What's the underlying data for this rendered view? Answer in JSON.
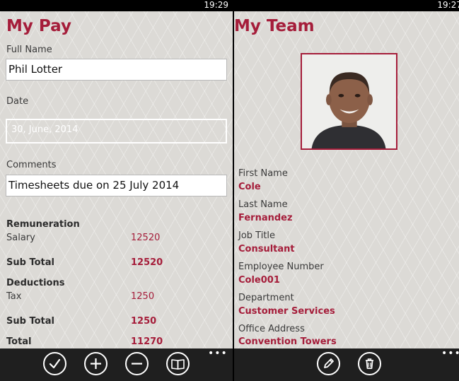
{
  "left": {
    "clock": "19:29",
    "title": "My Pay",
    "full_name": {
      "label": "Full Name",
      "value": "Phil Lotter"
    },
    "date": {
      "label": "Date",
      "value": "30, June, 2014"
    },
    "comments": {
      "label": "Comments",
      "value": "Timesheets due on 25 July 2014"
    },
    "remuneration_heading": "Remuneration",
    "salary": {
      "label": "Salary",
      "value": "12520"
    },
    "sub_total_1": {
      "label": "Sub Total",
      "value": "12520"
    },
    "deductions_heading": "Deductions",
    "tax": {
      "label": "Tax",
      "value": "1250"
    },
    "sub_total_2": {
      "label": "Sub Total",
      "value": "1250"
    },
    "total": {
      "label": "Total",
      "value": "11270"
    },
    "appbar_icons": [
      "check-icon",
      "add-icon",
      "remove-icon",
      "book-icon"
    ],
    "more": "•••"
  },
  "right": {
    "clock": "19:27",
    "title": "My Team",
    "first_name": {
      "label": "First Name",
      "value": "Cole"
    },
    "last_name": {
      "label": "Last Name",
      "value": "Fernandez"
    },
    "job_title": {
      "label": "Job Title",
      "value": "Consultant"
    },
    "employee_number": {
      "label": "Employee Number",
      "value": "Cole001"
    },
    "department": {
      "label": "Department",
      "value": "Customer Services"
    },
    "office_address": {
      "label": "Office Address",
      "value": "Convention Towers"
    },
    "appbar_icons": [
      "edit-icon",
      "delete-icon"
    ],
    "more": "•••"
  },
  "colors": {
    "accent": "#a51d3a",
    "background": "#dcdad6",
    "appbar": "#1f1f1f"
  }
}
